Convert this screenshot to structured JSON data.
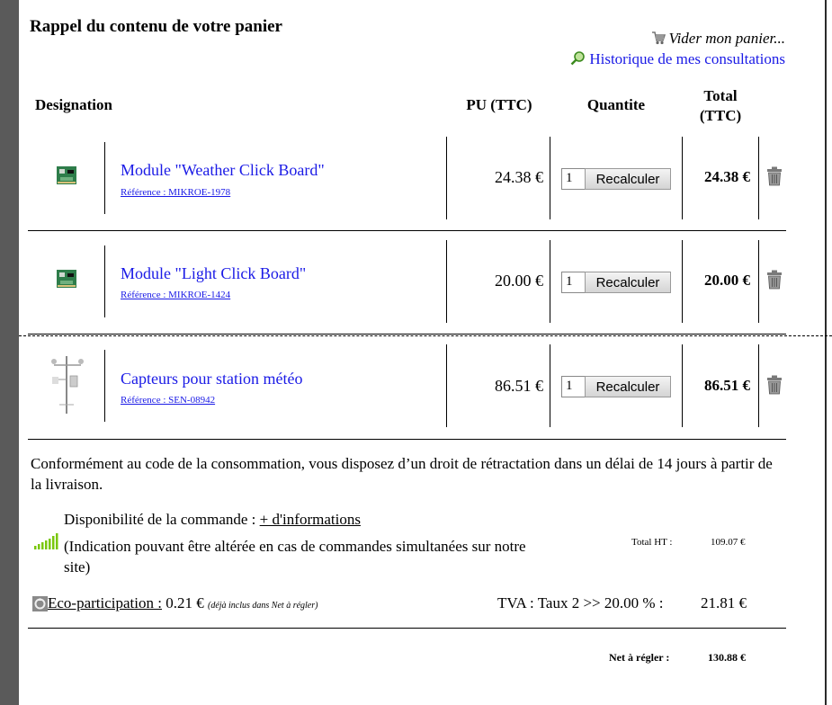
{
  "cart": {
    "title": "Rappel du contenu de votre panier",
    "empty_link": "Vider mon panier...",
    "history_link": "Historique de mes consultations",
    "headers": {
      "designation": "Designation",
      "pu": "PU (TTC)",
      "quantity": "Quantite",
      "total_line1": "Total",
      "total_line2": "(TTC)"
    },
    "items": [
      {
        "name": "Module \"Weather Click Board\"",
        "reference": "Référence : MIKROE-1978",
        "pu": "24.38 €",
        "qty": "1",
        "recalc": "Recalculer",
        "total": "24.38 €",
        "thumb_icon": "circuit-board-icon"
      },
      {
        "name": "Module \"Light Click Board\"",
        "reference": "Référence : MIKROE-1424",
        "pu": "20.00 €",
        "qty": "1",
        "recalc": "Recalculer",
        "total": "20.00 €",
        "thumb_icon": "circuit-board-icon"
      },
      {
        "name": "Capteurs pour station météo",
        "reference": "Référence : SEN-08942",
        "pu": "86.51 €",
        "qty": "1",
        "recalc": "Recalculer",
        "total": "86.51 €",
        "thumb_icon": "weather-station-icon"
      }
    ],
    "retraction_notice": "Conformément au code de la consommation, vous disposez d’un droit de rétractation dans un délai de 14 jours à partir de la livraison.",
    "availability": {
      "label": "Disponibilité de la commande : ",
      "link": "+ d'informations",
      "note": "(Indication pouvant être altérée en cas de commandes simultanées sur notre site)",
      "signal_color": "#7ac70c"
    },
    "eco": {
      "label": "Eco-participation :",
      "amount": " 0.21 €",
      "note": "(déjà inclus dans Net à régler)"
    },
    "totals": {
      "ht_label": "Total HT :",
      "ht_value": "109.07 €",
      "tva_label": "TVA : Taux 2 >> 20.00 % :",
      "tva_value": "21.81 €",
      "net_label": "Net à régler :",
      "net_value": "130.88 €"
    },
    "link_color": "#1a1ae6"
  }
}
